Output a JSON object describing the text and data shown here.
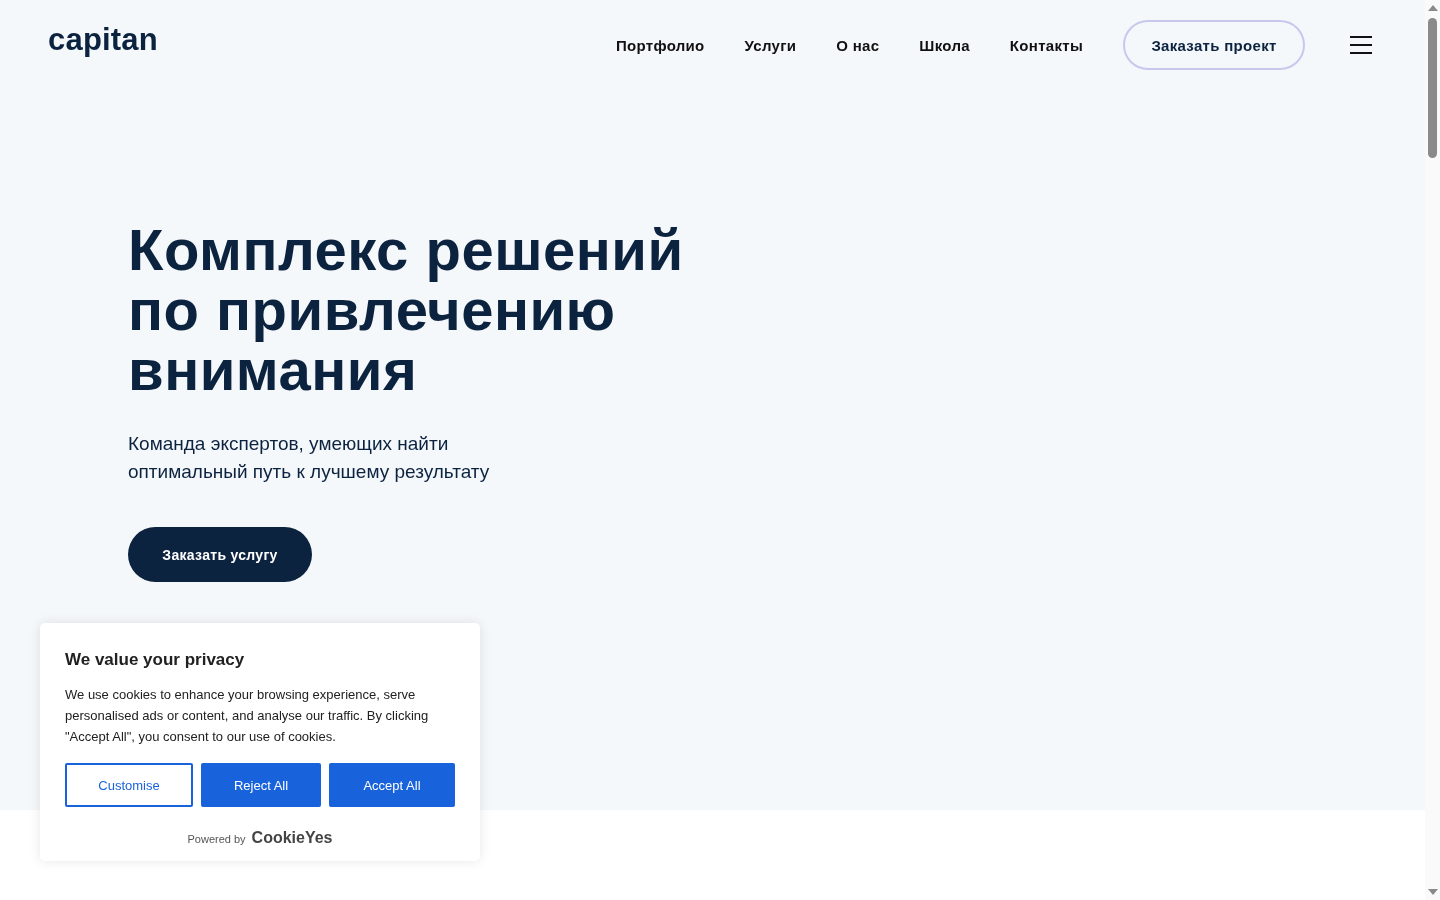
{
  "header": {
    "logo": "capitan",
    "nav": [
      "Портфолио",
      "Услуги",
      "О нас",
      "Школа",
      "Контакты"
    ],
    "cta": "Заказать проект"
  },
  "hero": {
    "title": "Комплекс решений по привлечению внимания",
    "subtitle": "Команда экспертов, умеющих найти оптимальный путь к лучшему результату",
    "button": "Заказать услугу"
  },
  "cookie_banner": {
    "title": "We value your privacy",
    "text": "We use cookies to enhance your browsing experience, serve personalised ads or content, and analyse our traffic. By clicking \"Accept All\", you consent to our use of cookies.",
    "buttons": [
      {
        "label": "Customise",
        "kind": "outline"
      },
      {
        "label": "Reject All",
        "kind": "filled"
      },
      {
        "label": "Accept All",
        "kind": "filled"
      }
    ],
    "powered_by": "Powered by",
    "brand": "CookieYes"
  }
}
